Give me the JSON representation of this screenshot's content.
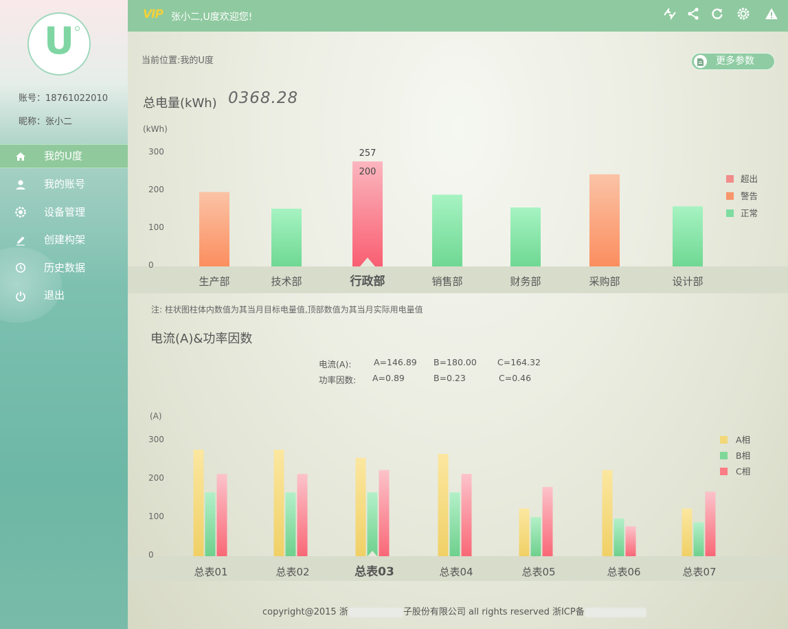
{
  "sidebar": {
    "logo_letter": "U",
    "account": "账号：18761022010",
    "nickname": "昵称：张小二",
    "menu": [
      {
        "label": "我的U度",
        "icon": "home-icon",
        "active": true
      },
      {
        "label": "我的账号",
        "icon": "user-icon",
        "active": false
      },
      {
        "label": "设备管理",
        "icon": "gear-icon",
        "active": false
      },
      {
        "label": "创建构架",
        "icon": "pencil-icon",
        "active": false
      },
      {
        "label": "历史数据",
        "icon": "clock-icon",
        "active": false
      },
      {
        "label": "退出",
        "icon": "power-icon",
        "active": false
      }
    ]
  },
  "header": {
    "vip": "VIP",
    "welcome": "张小二,U度欢迎您!",
    "icons": [
      "sync-icon",
      "share-icon",
      "refresh-icon",
      "settings-icon",
      "warning-icon"
    ]
  },
  "main": {
    "breadcrumb": "当前位置:我的U度",
    "more_button": "更多参数",
    "total_label": "总电量(kWh)",
    "total_value": "0368.28",
    "note": "注: 柱状图柱体内数值为其当月目标电量值,顶部数值为其当月实际用电量值",
    "section2_title": "电流(A)&功率因数",
    "current_label": "电流(A):",
    "current_a": "A=146.89",
    "current_b": "B=180.00",
    "current_c": "C=164.32",
    "pf_label": "功率因数:",
    "pf_a": "A=0.89",
    "pf_b": "B=0.23",
    "pf_c": "C=0.46"
  },
  "colors": {
    "over": "#f08c8a",
    "warn": "#f7956b",
    "normal": "#7fdca0",
    "phase_a": "#f3d878",
    "phase_b": "#7fd89a",
    "phase_c": "#fb7d86"
  },
  "chart_data": [
    {
      "type": "bar",
      "ylabel": "(kWh)",
      "ylim": [
        0,
        300
      ],
      "yticks": [
        0,
        100,
        200,
        300
      ],
      "categories": [
        "生产部",
        "技术部",
        "行政部",
        "销售部",
        "财务部",
        "采购部",
        "设计部"
      ],
      "selected_category": "行政部",
      "values": [
        197,
        153,
        278,
        190,
        156,
        244,
        159
      ],
      "status": [
        "警告",
        "正常",
        "超出",
        "正常",
        "正常",
        "警告",
        "正常"
      ],
      "data_labels": [
        {
          "category": "行政部",
          "top": "257",
          "inside": "200"
        }
      ],
      "legend": [
        "超出",
        "警告",
        "正常"
      ],
      "legend_position": "right"
    },
    {
      "type": "bar",
      "ylabel": "(A)",
      "ylim": [
        0,
        300
      ],
      "yticks": [
        0,
        100,
        200,
        300
      ],
      "categories": [
        "总表01",
        "总表02",
        "总表03",
        "总表04",
        "总表05",
        "总表06",
        "总表07"
      ],
      "selected_category": "总表03",
      "series": [
        {
          "name": "A相",
          "values": [
            277,
            277,
            256,
            266,
            124,
            224,
            124
          ]
        },
        {
          "name": "B相",
          "values": [
            166,
            166,
            166,
            166,
            102,
            98,
            88
          ]
        },
        {
          "name": "C相",
          "values": [
            214,
            214,
            224,
            214,
            180,
            78,
            168
          ]
        }
      ],
      "legend_position": "right"
    }
  ]
}
